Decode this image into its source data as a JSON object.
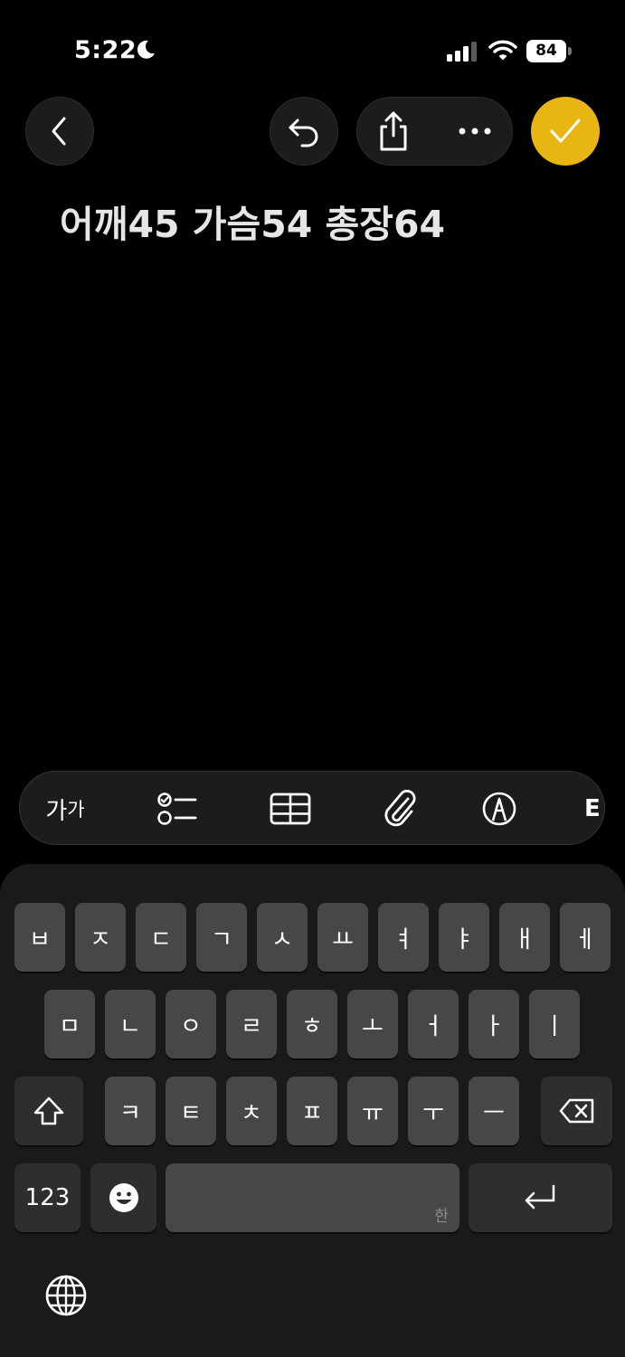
{
  "status_bar": {
    "time": "5:22",
    "battery": "84",
    "icons": [
      "moon-icon",
      "cellular-signal-icon",
      "wifi-icon",
      "battery-icon"
    ]
  },
  "toolbar": {
    "icons": [
      "chevron-left-icon",
      "undo-icon",
      "share-icon",
      "ellipsis-icon",
      "checkmark-icon"
    ],
    "accent_color": "#e9b512"
  },
  "note": {
    "text": "어깨45 가슴54 총장64"
  },
  "format_bar": {
    "text_style_label": "가",
    "text_style_label_small": "가",
    "icons": [
      "checklist-icon",
      "table-icon",
      "paperclip-icon",
      "markup-icon"
    ],
    "partial_label": "E"
  },
  "keyboard": {
    "row1": [
      "ㅂ",
      "ㅈ",
      "ㄷ",
      "ㄱ",
      "ㅅ",
      "ㅛ",
      "ㅕ",
      "ㅑ",
      "ㅐ",
      "ㅔ"
    ],
    "row2": [
      "ㅁ",
      "ㄴ",
      "ㅇ",
      "ㄹ",
      "ㅎ",
      "ㅗ",
      "ㅓ",
      "ㅏ",
      "ㅣ"
    ],
    "row3": [
      "ㅋ",
      "ㅌ",
      "ㅊ",
      "ㅍ",
      "ㅠ",
      "ㅜ",
      "ㅡ"
    ],
    "numbers_label": "123",
    "space_hint": "한",
    "icons": [
      "shift-icon",
      "delete-icon",
      "emoji-icon",
      "return-icon",
      "globe-icon"
    ]
  }
}
